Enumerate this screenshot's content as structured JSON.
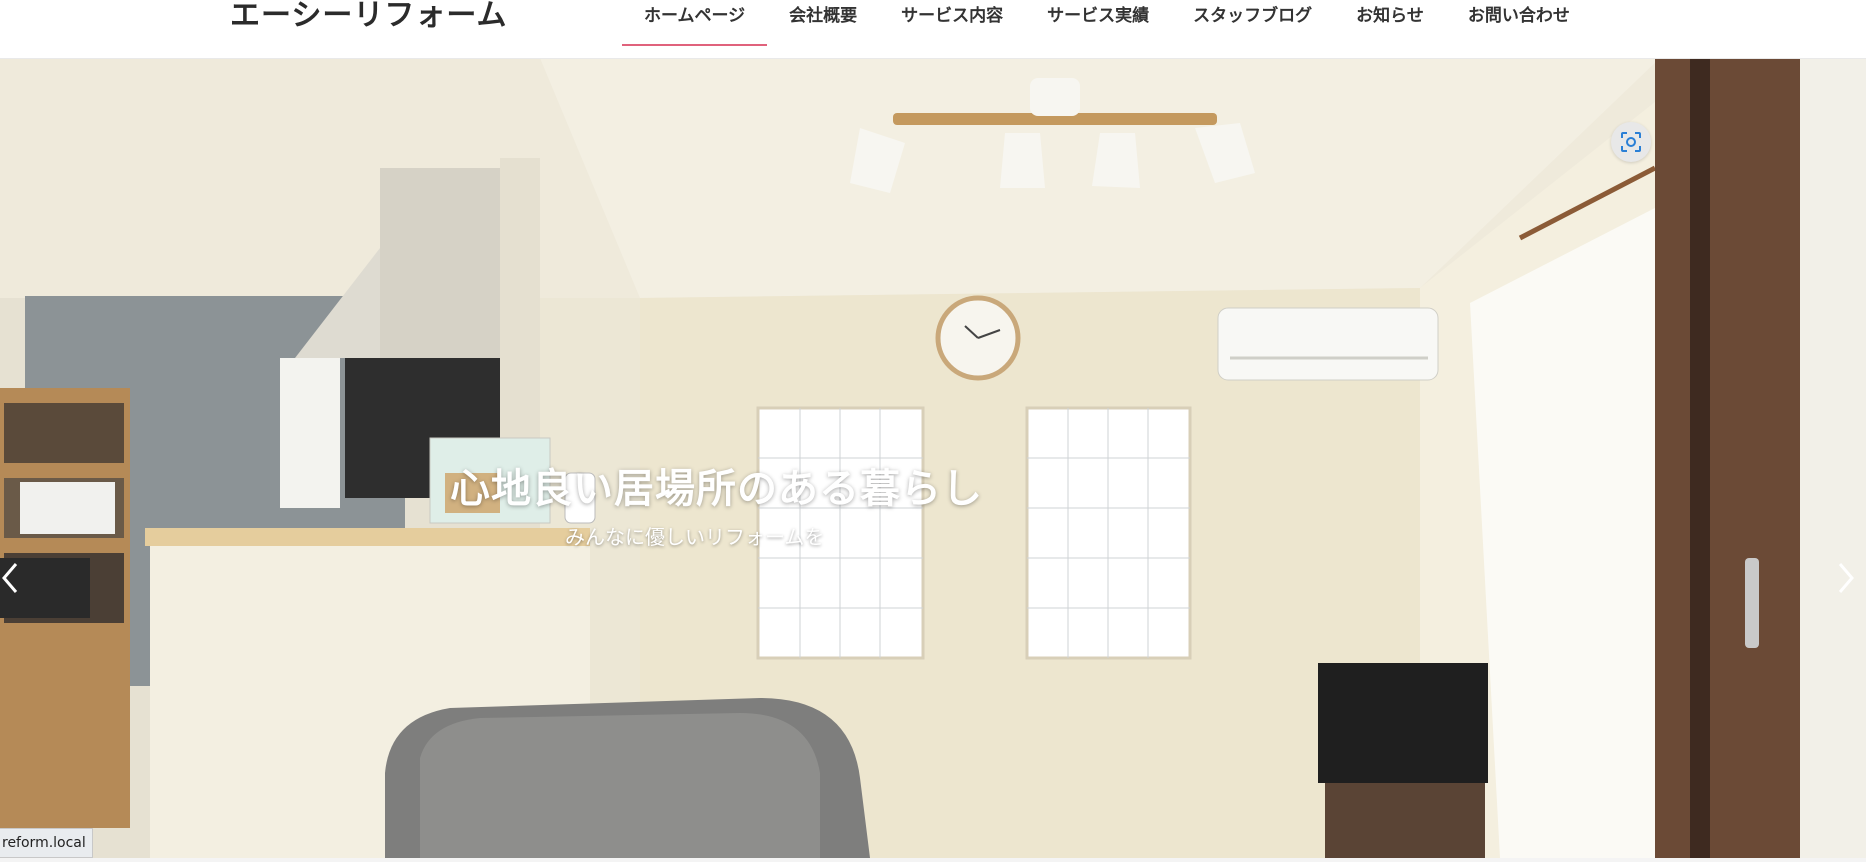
{
  "site": {
    "title": "エーシーリフォーム"
  },
  "nav": {
    "items": [
      {
        "label": "ホームページ",
        "active": true
      },
      {
        "label": "会社概要"
      },
      {
        "label": "サービス内容"
      },
      {
        "label": "サービス実績"
      },
      {
        "label": "スタッフブログ"
      },
      {
        "label": "お知らせ"
      },
      {
        "label": "お問い合わせ"
      }
    ]
  },
  "hero": {
    "title": "心地良い居場所のある暮らし",
    "subtitle": "みんなに優しいリフォームを",
    "prev_icon": "chevron-left-icon",
    "next_icon": "chevron-right-icon",
    "screenshot_icon": "screen-capture-icon"
  },
  "status_bar": {
    "url": "reform.local"
  },
  "colors": {
    "accent": "#e0627c",
    "text": "#333333",
    "wall": "#ece7d5"
  }
}
